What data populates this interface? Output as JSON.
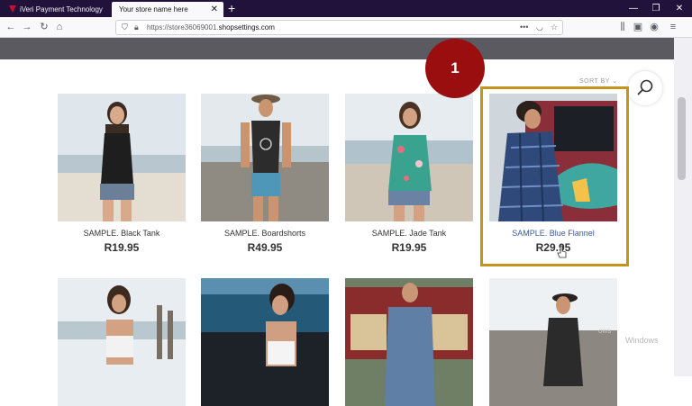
{
  "browser": {
    "tabs": [
      {
        "title": "iVeri Payment Technology Con",
        "active": false
      },
      {
        "title": "Your store name here",
        "active": true
      }
    ],
    "url_prefix": "https://store36069001.",
    "url_domain": "shopsettings.com"
  },
  "store": {
    "sort_label": "SORT BY",
    "products_row1": [
      {
        "name": "SAMPLE. Black Tank",
        "price": "R19.95"
      },
      {
        "name": "SAMPLE. Boardshorts",
        "price": "R49.95"
      },
      {
        "name": "SAMPLE. Jade Tank",
        "price": "R19.95"
      },
      {
        "name": "SAMPLE. Blue Flannel",
        "price": "R29.95"
      }
    ]
  },
  "annotation": {
    "step_number": "1",
    "highlight_color": "#c7931f",
    "badge_color": "#9b0e10"
  },
  "watermark": {
    "line1": "ows",
    "line2": "Windows"
  },
  "colors": {
    "tabbar": "#20123a",
    "header_band": "#5a5a60",
    "product_link": "#3d5a9a"
  }
}
